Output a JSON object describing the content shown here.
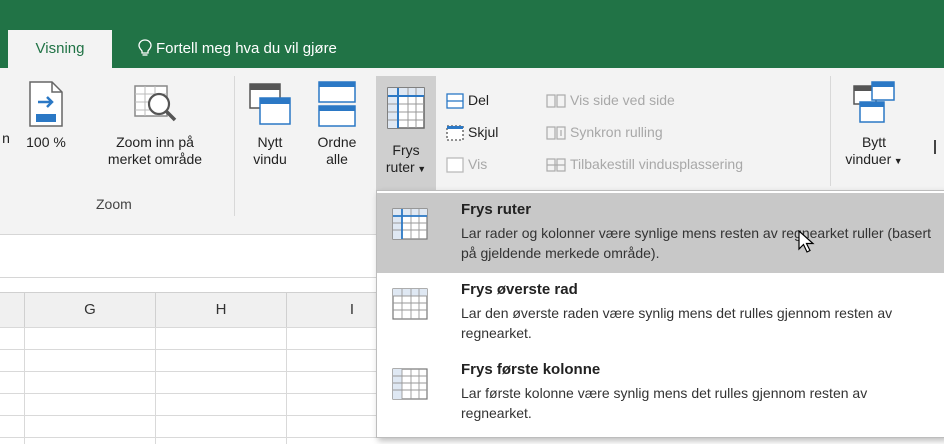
{
  "tabs": {
    "active_tab": "Visning",
    "tell_me": "Fortell meg hva du vil gjøre"
  },
  "ribbon": {
    "zoom_group": {
      "label": "Zoom",
      "cut_label": "n",
      "zoom_100": "100 %",
      "zoom_selection_line1": "Zoom inn på",
      "zoom_selection_line2": "merket område"
    },
    "window_group": {
      "new_window_line1": "Nytt",
      "new_window_line2": "vindu",
      "arrange_all_line1": "Ordne",
      "arrange_all_line2": "alle",
      "freeze_panes_line1": "Frys",
      "freeze_panes_line2": "ruter",
      "split": "Del",
      "hide": "Skjul",
      "unhide": "Vis",
      "view_side_by_side": "Vis side ved side",
      "synchronous_scrolling": "Synkron rulling",
      "reset_window_position": "Tilbakestill vindusplassering",
      "switch_windows_line1": "Bytt",
      "switch_windows_line2": "vinduer"
    }
  },
  "columns": [
    "G",
    "H",
    "I"
  ],
  "freeze_menu": {
    "items": [
      {
        "title": "Frys ruter",
        "desc": "Lar rader og kolonner være synlige mens resten av regnearket ruller (basert på gjeldende merkede område)."
      },
      {
        "title": "Frys øverste rad",
        "desc": "Lar den øverste raden være synlig mens det rulles gjennom resten av regnearket."
      },
      {
        "title": "Frys første kolonne",
        "desc": "Lar første kolonne være synlig mens det rulles gjennom resten av regnearket."
      }
    ]
  }
}
